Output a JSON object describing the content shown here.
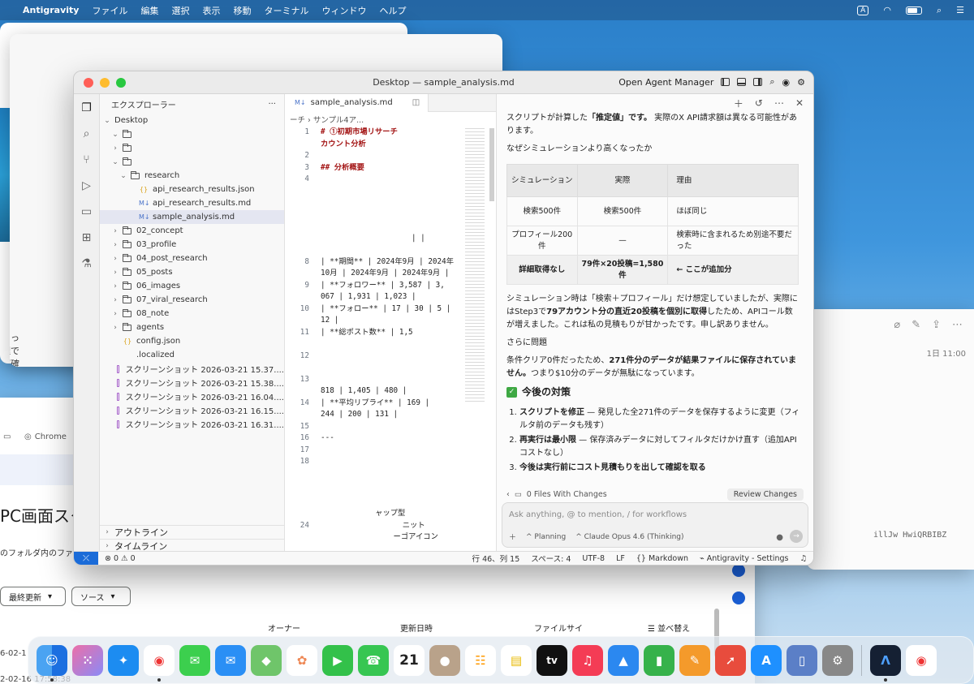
{
  "menubar": {
    "app": "Antigravity",
    "items": [
      "ファイル",
      "編集",
      "選択",
      "表示",
      "移動",
      "ターミナル",
      "ウィンドウ",
      "ヘルプ"
    ],
    "input_badge": "A"
  },
  "bg_window": {
    "lines": [
      "たっ",
      "理で",
      "ご確"
    ]
  },
  "drive": {
    "tab1": "",
    "tab2": "Chrome",
    "heading": "PC画面スク",
    "desc": "のフォルダ内のファ",
    "filter1": "最終更新",
    "filter2": "ソース",
    "col_owner": "オーナー",
    "col_updated": "更新日時",
    "col_size": "ファイルサイ",
    "col_sort": "並べ替え",
    "row1": "6-02-1",
    "row2": "2-02-16 17:58:38"
  },
  "notes": {
    "date": "1日 11:00",
    "code": "illJw        HwiQRBIBZ"
  },
  "ide": {
    "title": "Desktop — sample_analysis.md",
    "agent_manager": "Open Agent Manager",
    "sidebar": {
      "header": "エクスプローラー",
      "root": "Desktop",
      "items": [
        {
          "depth": 1,
          "type": "folder",
          "open": true,
          "label": ""
        },
        {
          "depth": 1,
          "type": "folder",
          "open": false,
          "label": ""
        },
        {
          "depth": 1,
          "type": "folder",
          "open": true,
          "label": ""
        },
        {
          "depth": 2,
          "type": "folder",
          "open": true,
          "label": "research"
        },
        {
          "depth": 3,
          "type": "json",
          "label": "api_research_results.json"
        },
        {
          "depth": 3,
          "type": "md",
          "label": "api_research_results.md"
        },
        {
          "depth": 3,
          "type": "md",
          "label": "sample_analysis.md",
          "selected": true
        },
        {
          "depth": 1,
          "type": "folder",
          "label": "02_concept"
        },
        {
          "depth": 1,
          "type": "folder",
          "label": "03_profile"
        },
        {
          "depth": 1,
          "type": "folder",
          "label": "04_post_research"
        },
        {
          "depth": 1,
          "type": "folder",
          "label": "05_posts"
        },
        {
          "depth": 1,
          "type": "folder",
          "label": "06_images"
        },
        {
          "depth": 1,
          "type": "folder",
          "label": "07_viral_research"
        },
        {
          "depth": 1,
          "type": "folder",
          "label": "08_note"
        },
        {
          "depth": 1,
          "type": "folder",
          "label": "agents"
        },
        {
          "depth": 1,
          "type": "json",
          "label": "config.json"
        },
        {
          "depth": 1,
          "type": "file",
          "label": ".localized"
        },
        {
          "depth": 1,
          "type": "img",
          "label": "スクリーンショット 2026-03-21 15.37...."
        },
        {
          "depth": 1,
          "type": "img",
          "label": "スクリーンショット 2026-03-21 15.38...."
        },
        {
          "depth": 1,
          "type": "img",
          "label": "スクリーンショット 2026-03-21 16.04...."
        },
        {
          "depth": 1,
          "type": "img",
          "label": "スクリーンショット 2026-03-21 16.15...."
        },
        {
          "depth": 1,
          "type": "img",
          "label": "スクリーンショット 2026-03-21 16.31...."
        }
      ],
      "outline": "アウトライン",
      "timeline": "タイムライン"
    },
    "editor": {
      "tab": "sample_analysis.md",
      "breadcrumb": "ーチ › サンプル4ア...",
      "lines": [
        {
          "n": "1",
          "t": "# ①初期市場リサーチ",
          "c": "h1"
        },
        {
          "n": "",
          "t": "カウント分析",
          "c": "h1"
        },
        {
          "n": "2",
          "t": ""
        },
        {
          "n": "3",
          "t": "## 分析概要",
          "c": "h1"
        },
        {
          "n": "4",
          "t": ""
        },
        {
          "n": "",
          "t": ""
        },
        {
          "n": "",
          "t": ""
        },
        {
          "n": "",
          "t": ""
        },
        {
          "n": "",
          "t": ""
        },
        {
          "n": "",
          "t": "                    | |"
        },
        {
          "n": "",
          "t": ""
        },
        {
          "n": "8",
          "t": "| **期間** | 2024年9月 | 2024年"
        },
        {
          "n": "",
          "t": "10月 | 2024年9月 | 2024年9月 |"
        },
        {
          "n": "9",
          "t": "| **フォロワー** | 3,587 | 3,"
        },
        {
          "n": "",
          "t": "067 | 1,931 | 1,023 |"
        },
        {
          "n": "10",
          "t": "| **フォロー** | 17 | 30 | 5 |"
        },
        {
          "n": "",
          "t": "12 |"
        },
        {
          "n": "11",
          "t": "| **総ポスト数** | 1,5"
        },
        {
          "n": "",
          "t": ""
        },
        {
          "n": "12",
          "t": ""
        },
        {
          "n": "",
          "t": ""
        },
        {
          "n": "13",
          "t": ""
        },
        {
          "n": "",
          "t": "818 | 1,405 | 480 |"
        },
        {
          "n": "14",
          "t": "| **平均リプライ** | 169 |"
        },
        {
          "n": "",
          "t": "244 | 200 | 131 |"
        },
        {
          "n": "15",
          "t": ""
        },
        {
          "n": "16",
          "t": "---"
        },
        {
          "n": "17",
          "t": ""
        },
        {
          "n": "18",
          "t": ""
        }
      ],
      "tail": [
        {
          "n": "",
          "t": "            ャップ型"
        },
        {
          "n": "24",
          "t": "                  ニット"
        },
        {
          "n": "",
          "t": "                ーゴアイコン"
        }
      ]
    },
    "chat": {
      "p1_pre": "スクリプトが計算した",
      "p1_bold": "「推定値」です。",
      "p1_post": " 実際のX API請求額は異なる可能性があります。",
      "p2": "なぜシミュレーションより高くなったか",
      "table": {
        "headers": [
          "シミュレーション",
          "実際",
          "理由"
        ],
        "rows": [
          [
            "検索500件",
            "検索500件",
            "ほぼ同じ"
          ],
          [
            "プロフィール200件",
            "—",
            "検索時に含まれるため別途不要だった"
          ],
          [
            "詳細取得なし",
            "79件×20投稿=1,580件",
            "← ここが追加分"
          ]
        ]
      },
      "p3_a": "シミュレーション時は「検索＋プロフィール」だけ想定していましたが、実際にはStep3で",
      "p3_b": "79アカウント分の直近20投稿を個別に取得",
      "p3_c": "したため、APIコール数が増えました。これは私の見積もりが甘かったです。申し訳ありません。",
      "p4": "さらに問題",
      "p5_a": "条件クリア0件だったため、",
      "p5_b": "271件分のデータが結果ファイルに保存されていません。",
      "p5_c": "つまり$10分のデータが無駄になっています。",
      "h2": "今後の対策",
      "list": [
        {
          "b": "スクリプトを修正",
          "t": " — 発見した全271件のデータを保存するように変更（フィルタ前のデータも残す）"
        },
        {
          "b": "再実行は最小限",
          "t": " — 保存済みデータに対してフィルタだけかけ直す（追加APIコストなし）"
        },
        {
          "b": "今後は実行前にコスト見積もりを出して確認を取る",
          "t": ""
        }
      ],
      "files_changed": "0 Files With Changes",
      "review": "Review Changes",
      "placeholder": "Ask anything, @ to mention, / for workflows",
      "planning": "Planning",
      "model": "Claude Opus 4.6 (Thinking)"
    },
    "status": {
      "problems": "0",
      "warnings": "0",
      "position": "行 46、列 15",
      "spaces": "スペース: 4",
      "encoding": "UTF-8",
      "eol": "LF",
      "lang": "{} Markdown",
      "settings": "Antigravity - Settings"
    }
  },
  "dock": {
    "calendar_day": "21",
    "tv": "tv"
  },
  "colors": {
    "accent": "#1a6bd8",
    "selection": "#e4e6f1",
    "check_green": "#3ea843"
  }
}
